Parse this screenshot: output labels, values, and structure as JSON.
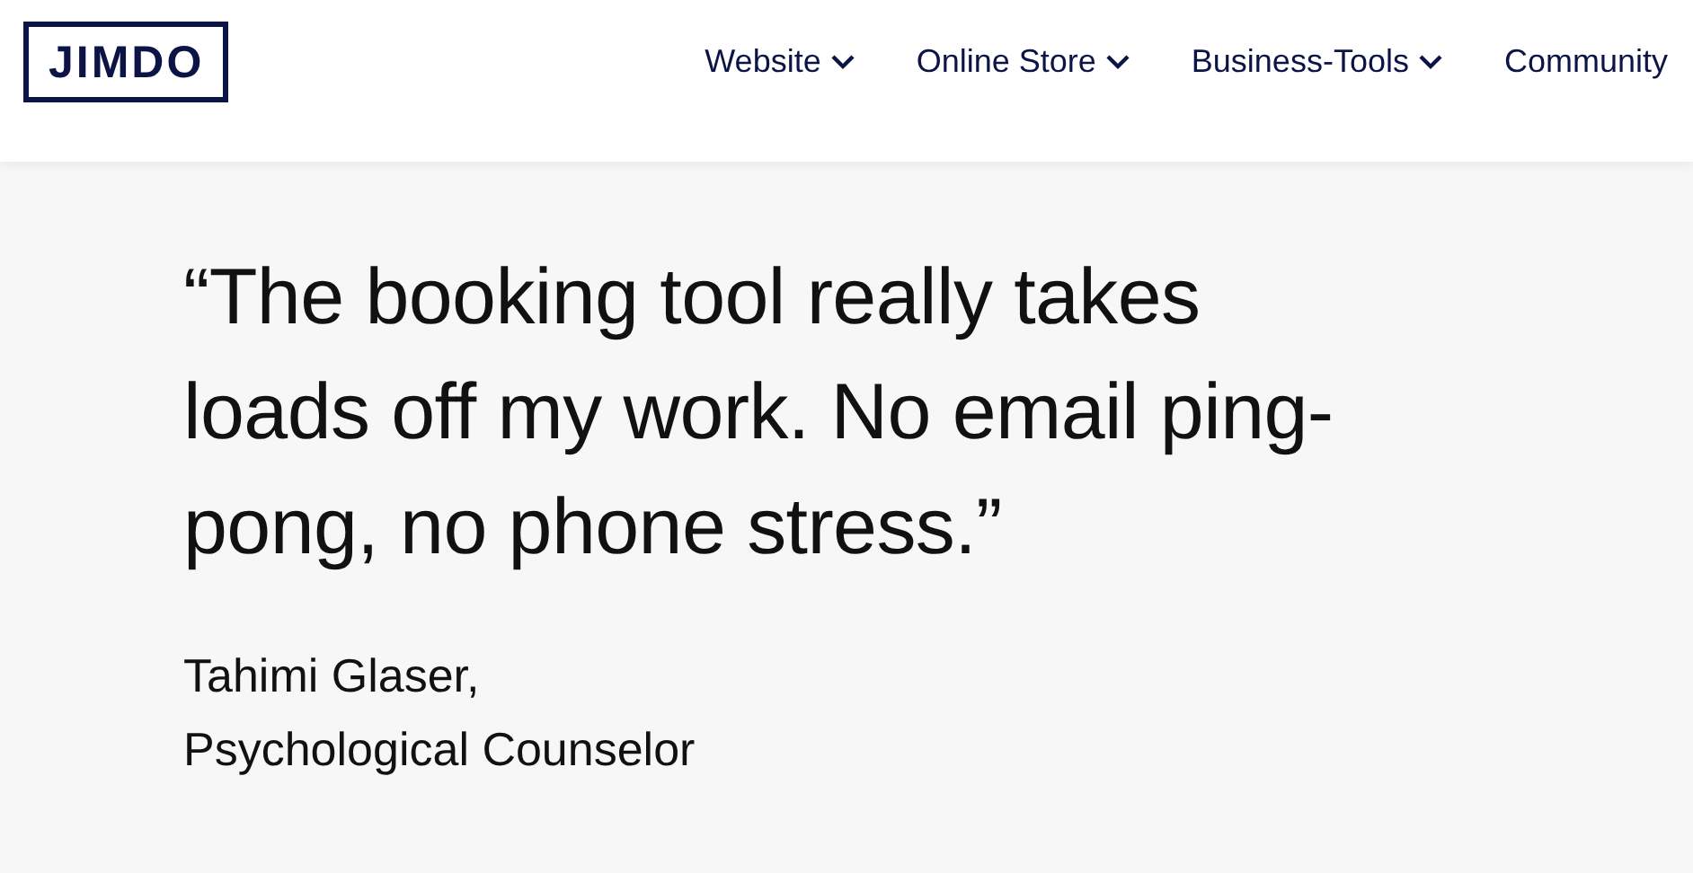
{
  "header": {
    "logo": "JIMDO",
    "nav": [
      {
        "label": "Website",
        "dropdown": true
      },
      {
        "label": "Online Store",
        "dropdown": true
      },
      {
        "label": "Business-Tools",
        "dropdown": true
      },
      {
        "label": "Community",
        "dropdown": false
      }
    ]
  },
  "testimonial": {
    "quote": "“The booking tool really takes loads off my work. No email ping-pong, no phone stress.”",
    "author": "Tahimi Glaser,",
    "role": "Psychological Counselor"
  }
}
